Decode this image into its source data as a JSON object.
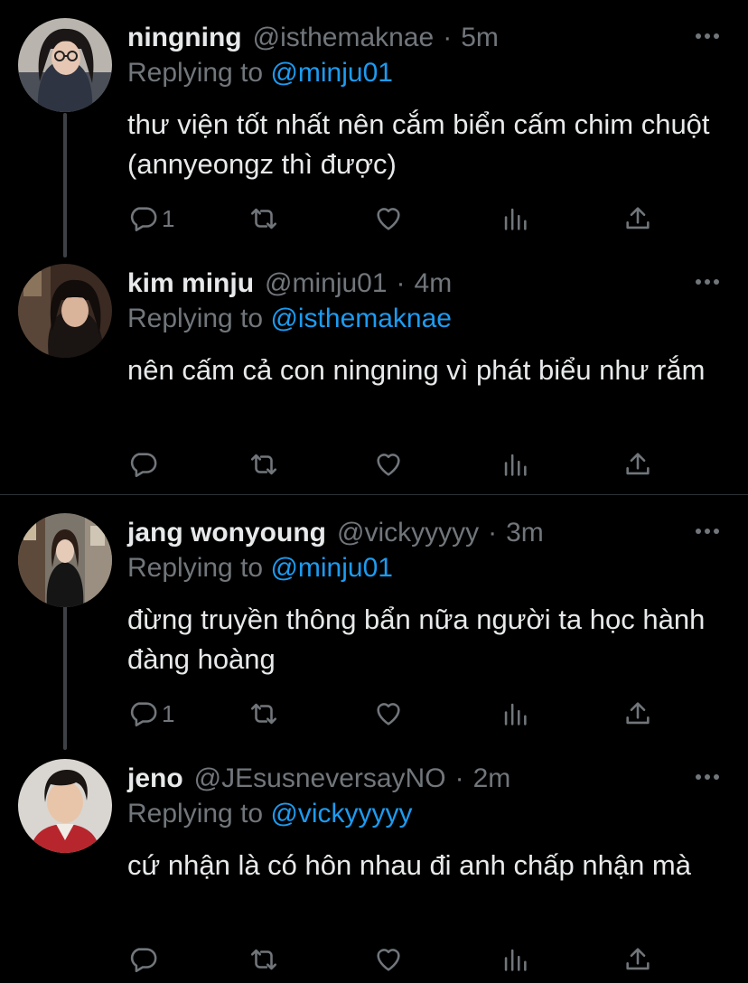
{
  "tweets": [
    {
      "name": "ningning",
      "handle": "@isthemaknae",
      "separator": "·",
      "time": "5m",
      "replying_prefix": "Replying to ",
      "replying_to": "@minju01",
      "text": "thư viện tốt nhất nên cắm biển cấm chim chuột (annyeongz thì được)",
      "reply_count": "1"
    },
    {
      "name": "kim minju",
      "handle": "@minju01",
      "separator": "·",
      "time": "4m",
      "replying_prefix": "Replying to ",
      "replying_to": "@isthemaknae",
      "text": "nên cấm cả con ningning vì phát biểu như rắm",
      "reply_count": ""
    },
    {
      "name": "jang wonyoung",
      "handle": "@vickyyyyy",
      "separator": "·",
      "time": "3m",
      "replying_prefix": "Replying to ",
      "replying_to": "@minju01",
      "text": "đừng truyền thông bẩn nữa người ta học hành đàng hoàng",
      "reply_count": "1"
    },
    {
      "name": "jeno",
      "handle": "@JEsusneversayNO",
      "separator": "·",
      "time": "2m",
      "replying_prefix": "Replying to ",
      "replying_to": "@vickyyyyy",
      "text": "cứ nhận là có hôn nhau đi anh chấp nhận mà",
      "reply_count": ""
    }
  ],
  "icons": {
    "reply": "reply-icon",
    "retweet": "retweet-icon",
    "like": "like-icon",
    "stats": "stats-icon",
    "share": "share-icon",
    "more": "more-icon"
  },
  "colors": {
    "background": "#000000",
    "text": "#e7e9ea",
    "secondary": "#71767b",
    "accent": "#1d9bf0",
    "thread_line": "#3d4146"
  }
}
